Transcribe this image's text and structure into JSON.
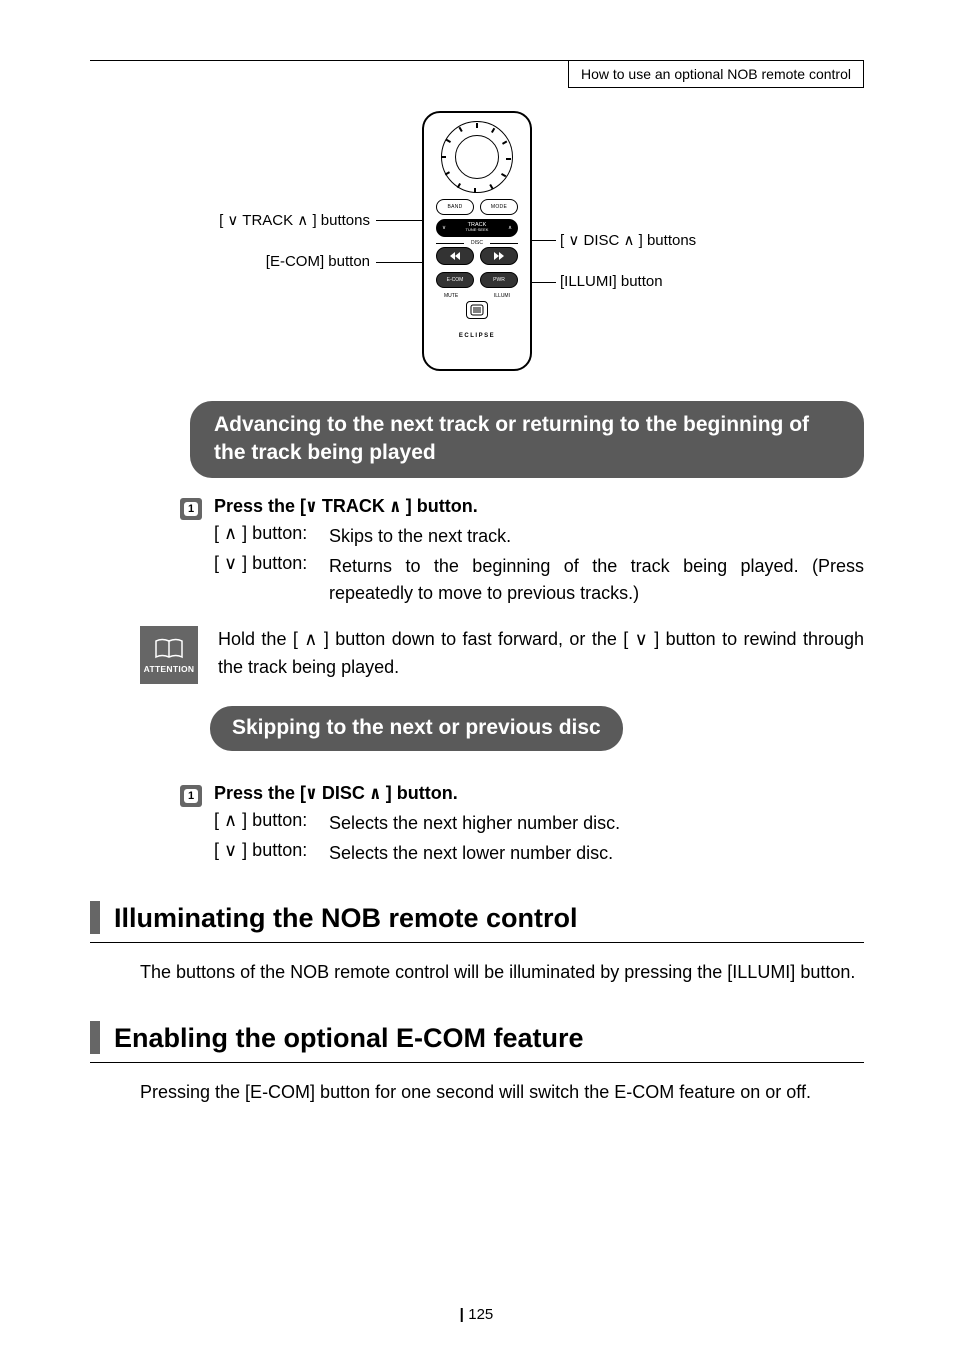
{
  "header": {
    "title": "How to use an optional NOB remote control"
  },
  "diagram": {
    "left1": "[ ∨ TRACK ∧ ] buttons",
    "left2": "[E-COM] button",
    "right1": "[ ∨ DISC ∧ ] buttons",
    "right2": "[ILLUMI] button",
    "remote": {
      "band": "BAND",
      "mode": "MODE",
      "track": "TRACK",
      "tune": "TUNE·SEEK",
      "disc": "DISC",
      "ecom": "E-COM",
      "pwr": "PWR",
      "mute": "MUTE",
      "illumi": "ILLUMI",
      "brand": "ECLIPSE"
    }
  },
  "banner1": "Advancing to the next track or returning to the beginning of the track being played",
  "step1": {
    "num": "1",
    "head_pre": "Press the [",
    "head_sym1": "∨",
    "head_mid": " TRACK ",
    "head_sym2": "∧",
    "head_post": " ] button.",
    "up_k": "[ ∧ ] button:",
    "up_v": "Skips to the next track.",
    "dn_k": "[ ∨ ] button:",
    "dn_v": "Returns to the beginning of the track being played. (Press repeatedly to move to previous tracks.)"
  },
  "attention": {
    "label": "ATTENTION",
    "text": "Hold the [ ∧ ] button down to fast forward, or the [ ∨ ] button to rewind through the track being played."
  },
  "banner2": "Skipping to the next or previous disc",
  "step2": {
    "num": "1",
    "head_pre": "Press the [",
    "head_sym1": "∨",
    "head_mid": " DISC ",
    "head_sym2": "∧",
    "head_post": " ] button.",
    "up_k": "[ ∧ ] button:",
    "up_v": "Selects the next higher number disc.",
    "dn_k": "[ ∨ ] button:",
    "dn_v": "Selects the next lower number disc."
  },
  "section1": {
    "title": "Illuminating the NOB remote control",
    "body": "The buttons of the NOB remote control will be illuminated by pressing the [ILLUMI] button."
  },
  "section2": {
    "title": "Enabling the optional E-COM feature",
    "body": "Pressing the [E-COM] button for one second will switch the E-COM feature on or off."
  },
  "page": "125"
}
